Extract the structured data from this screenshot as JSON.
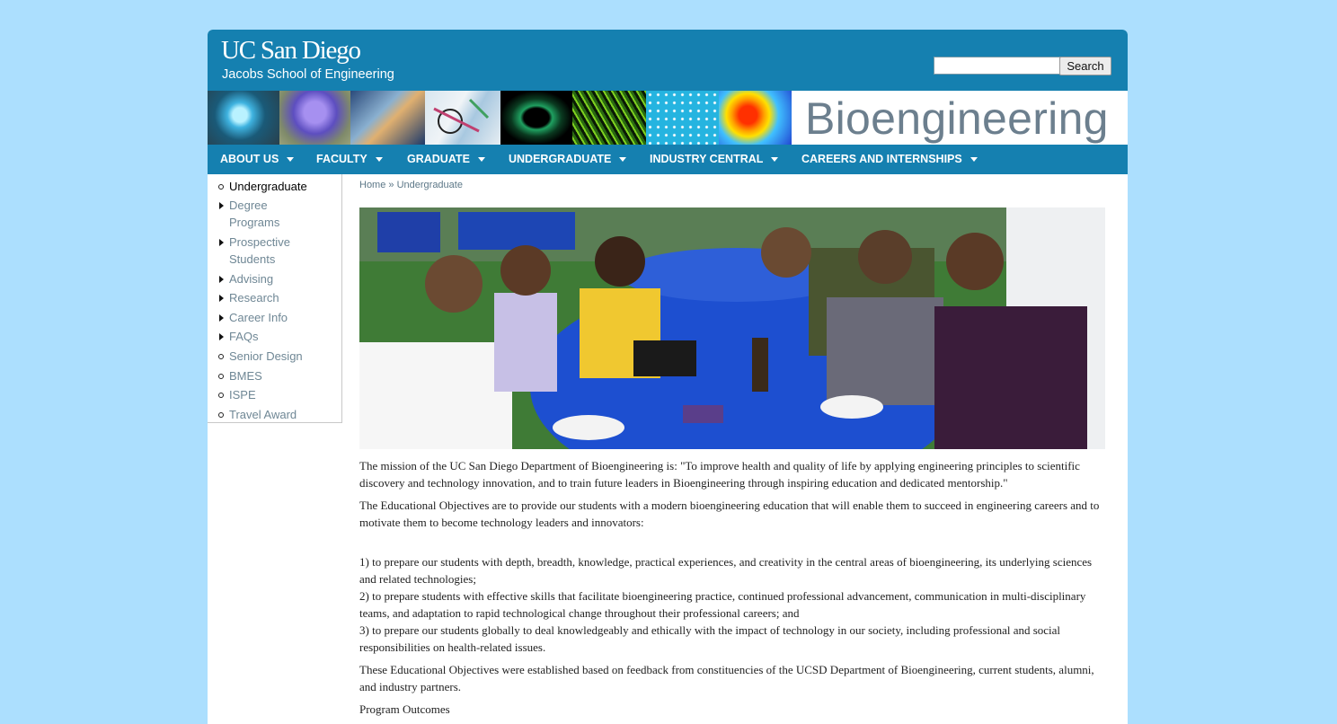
{
  "header": {
    "logo_main": "UC San Diego",
    "logo_sub": "Jacobs School of Engineering",
    "search_value": "",
    "search_button": "Search"
  },
  "banner": {
    "title": "Bioengineering"
  },
  "nav": {
    "items": [
      {
        "label": "ABOUT US"
      },
      {
        "label": "FACULTY"
      },
      {
        "label": "GRADUATE"
      },
      {
        "label": "UNDERGRADUATE"
      },
      {
        "label": "INDUSTRY CENTRAL"
      },
      {
        "label": "CAREERS AND INTERNSHIPS"
      }
    ]
  },
  "sidebar": {
    "items": [
      {
        "label": "Undergraduate"
      },
      {
        "label": "Degree Programs"
      },
      {
        "label": "Prospective Students"
      },
      {
        "label": "Advising"
      },
      {
        "label": "Research"
      },
      {
        "label": "Career Info"
      },
      {
        "label": "FAQs"
      },
      {
        "label": "Senior Design"
      },
      {
        "label": "BMES"
      },
      {
        "label": "ISPE"
      },
      {
        "label": "Travel Award"
      }
    ]
  },
  "breadcrumb": {
    "home": "Home",
    "separator": " » ",
    "current": "Undergraduate"
  },
  "content": {
    "p1": "The mission of the UC San Diego Department of Bioengineering is: \"To improve health and quality of life by applying engineering principles to scientific discovery and technology innovation, and to train future leaders in Bioengineering through inspiring education and dedicated mentorship.\"",
    "p2": "The Educational Objectives are to provide our students with a modern bioengineering education that will enable them to succeed in engineering careers and to motivate them to become technology leaders and innovators:",
    "obj1": "1) to prepare our students with depth, breadth, knowledge, practical experiences, and creativity in the central areas of bioengineering, its underlying sciences and related technologies;",
    "obj2": "2) to prepare students with effective skills that facilitate bioengineering practice, continued professional advancement, communication in multi-disciplinary teams, and adaptation to rapid technological change throughout their professional careers; and",
    "obj3": "3) to prepare our students globally to deal knowledgeably and ethically with the impact of technology in our society, including professional and social responsibilities on health-related issues.",
    "p3": "These Educational Objectives were established based on feedback from constituencies of the UCSD Department of Bioengineering, current students, alumni, and industry partners.",
    "p4": "Program Outcomes"
  },
  "colors": {
    "page_background": "#acdffe",
    "brand_blue": "#1580b0",
    "banner_title": "#6c7f8e",
    "link": "#5d7888"
  }
}
